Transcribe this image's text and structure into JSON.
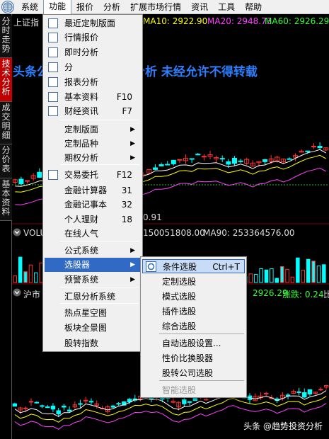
{
  "menubar": {
    "items": [
      "系统",
      "功能",
      "报价",
      "分析",
      "扩展市场行情",
      "资讯",
      "工具",
      "帮助"
    ],
    "active_index": 1
  },
  "side_tabs": [
    "分时走势",
    "技术分析",
    "成交明细",
    "分价表",
    "基本资料"
  ],
  "side_tab_active": 1,
  "chart": {
    "title_fragment": "上证指",
    "ma10": "MA10: 2922.90",
    "ma20": "MA20: 2948.73",
    "ma60": "MA60: 2926.29",
    "value_fragment": "0.91",
    "vol_label": "VOLU",
    "vol_value": "150051808.00",
    "ma90": "MA90: 253364576.00",
    "lower_title": "沪市",
    "lower_ma": "2926.29",
    "lower_change": "涨跌: 0.24",
    "lower_change_tail": "比"
  },
  "watermark": "头条公众号：趋势投资分析    未经允许不得转载",
  "footer_mark": "头条 @趋势投资分析",
  "dropdown": {
    "items": [
      {
        "label": "最近定制版面",
        "shortcut": "",
        "arrow": false,
        "icon": "layout-icon"
      },
      {
        "label": "行情报价",
        "shortcut": "",
        "arrow": false,
        "icon": "table-icon"
      },
      {
        "label": "即时分析",
        "shortcut": "",
        "arrow": false,
        "icon": "line-chart-icon"
      },
      {
        "label": "分",
        "shortcut": "",
        "arrow": false,
        "icon": "tech-chart-icon"
      },
      {
        "label": "报表分析",
        "shortcut": "",
        "arrow": false,
        "icon": "report-icon"
      },
      {
        "label": "基本资料",
        "shortcut": "F10",
        "arrow": false,
        "icon": "f10-icon"
      },
      {
        "label": "财经资讯",
        "shortcut": "F7",
        "arrow": false,
        "icon": "news-icon"
      },
      {
        "label": "定制版面",
        "shortcut": "",
        "arrow": true
      },
      {
        "label": "定制品种",
        "shortcut": "",
        "arrow": true
      },
      {
        "label": "期权分析",
        "shortcut": "",
        "arrow": true
      },
      {
        "label": "交易委托",
        "shortcut": "F12",
        "arrow": false,
        "icon": "f12-icon"
      },
      {
        "label": "金融计算器",
        "shortcut": "31",
        "arrow": false
      },
      {
        "label": "金融记事本",
        "shortcut": "32",
        "arrow": false
      },
      {
        "label": "个人理财",
        "shortcut": "18",
        "arrow": false
      },
      {
        "label": "在线人气",
        "shortcut": "",
        "arrow": false
      },
      {
        "label": "公式系统",
        "shortcut": "",
        "arrow": true
      },
      {
        "label": "选股器",
        "shortcut": "",
        "arrow": true
      },
      {
        "label": "预警系统",
        "shortcut": "",
        "arrow": true
      },
      {
        "label": "汇恩分析系统",
        "shortcut": "",
        "arrow": false
      },
      {
        "label": "热点星空图",
        "shortcut": "",
        "arrow": false
      },
      {
        "label": "板块全景图",
        "shortcut": "",
        "arrow": false
      },
      {
        "label": "股转指数",
        "shortcut": "",
        "arrow": false
      }
    ],
    "highlighted_index": 16
  },
  "submenu": {
    "items": [
      {
        "label": "条件选股",
        "shortcut": "Ctrl+T",
        "disabled": false
      },
      {
        "label": "定制选股",
        "shortcut": "",
        "disabled": false
      },
      {
        "label": "模式选股",
        "shortcut": "",
        "disabled": false
      },
      {
        "label": "插件选股",
        "shortcut": "",
        "disabled": false
      },
      {
        "label": "综合选股",
        "shortcut": "",
        "disabled": false
      },
      {
        "label": "自动选股设置...",
        "shortcut": "",
        "disabled": false
      },
      {
        "label": "性价比换股器",
        "shortcut": "",
        "disabled": false
      },
      {
        "label": "股转公司选股",
        "shortcut": "",
        "disabled": false
      },
      {
        "label": "智能选股",
        "shortcut": "",
        "disabled": true
      }
    ],
    "highlighted_index": 0
  },
  "colors": {
    "up": "#ff3333",
    "down": "#00ffff",
    "ma_yellow": "#ffff00",
    "ma_white": "#ffffff",
    "ma_magenta": "#ff40ff",
    "ma_green": "#33ff33",
    "menu_highlight": "#316ac5"
  }
}
